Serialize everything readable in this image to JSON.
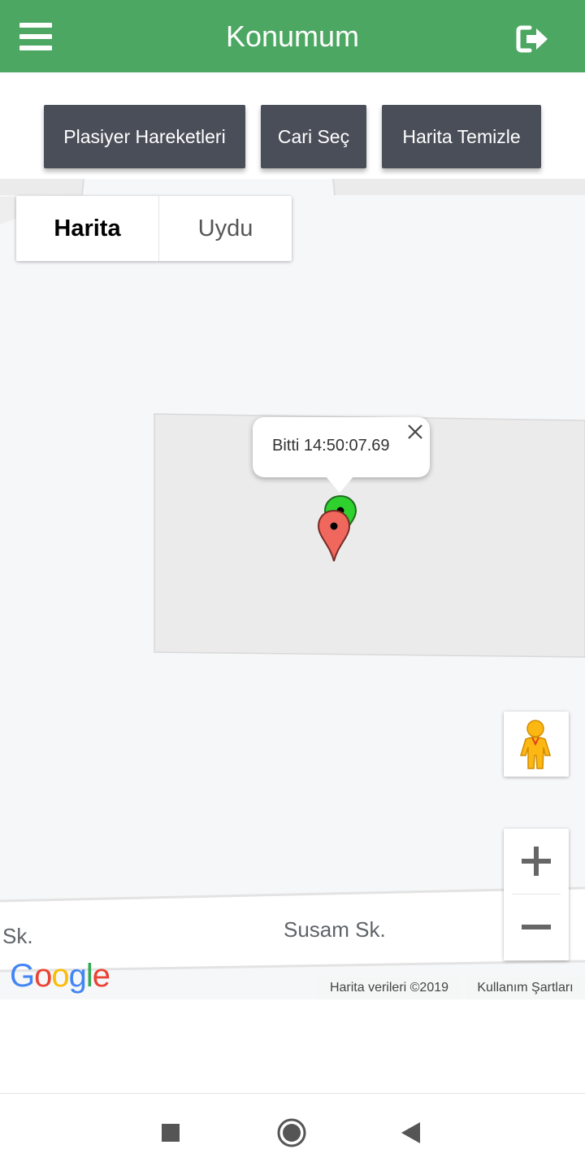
{
  "appbar": {
    "title": "Konumum",
    "background": "#4ca762",
    "menu_icon": "hamburger-menu-icon",
    "logout_icon": "logout-icon"
  },
  "actions": {
    "plasiyer_label": "Plasiyer Hareketleri",
    "cari_label": "Cari Seç",
    "temizle_label": "Harita Temizle",
    "button_color": "#4a4e58"
  },
  "map": {
    "maptype_active": "Harita",
    "maptype_inactive": "Uydu",
    "infowindow_text": "Bitti 14:50:07.69",
    "street_left": "Sk.",
    "street_center": "Susam Sk.",
    "logo_letters": [
      "G",
      "o",
      "o",
      "g",
      "l",
      "e"
    ],
    "logo_colors": [
      "#4285f4",
      "#ea4335",
      "#fbbc05",
      "#4285f4",
      "#34a853",
      "#ea4335"
    ],
    "attribution_data": "Harita verileri ©2019",
    "attribution_terms": "Kullanım Şartları",
    "marker_green_color": "#2ed12e",
    "marker_red_color": "#f0675d"
  },
  "navbar": {
    "recents_icon": "recents-square-icon",
    "home_icon": "home-circle-icon",
    "back_icon": "back-triangle-icon"
  }
}
